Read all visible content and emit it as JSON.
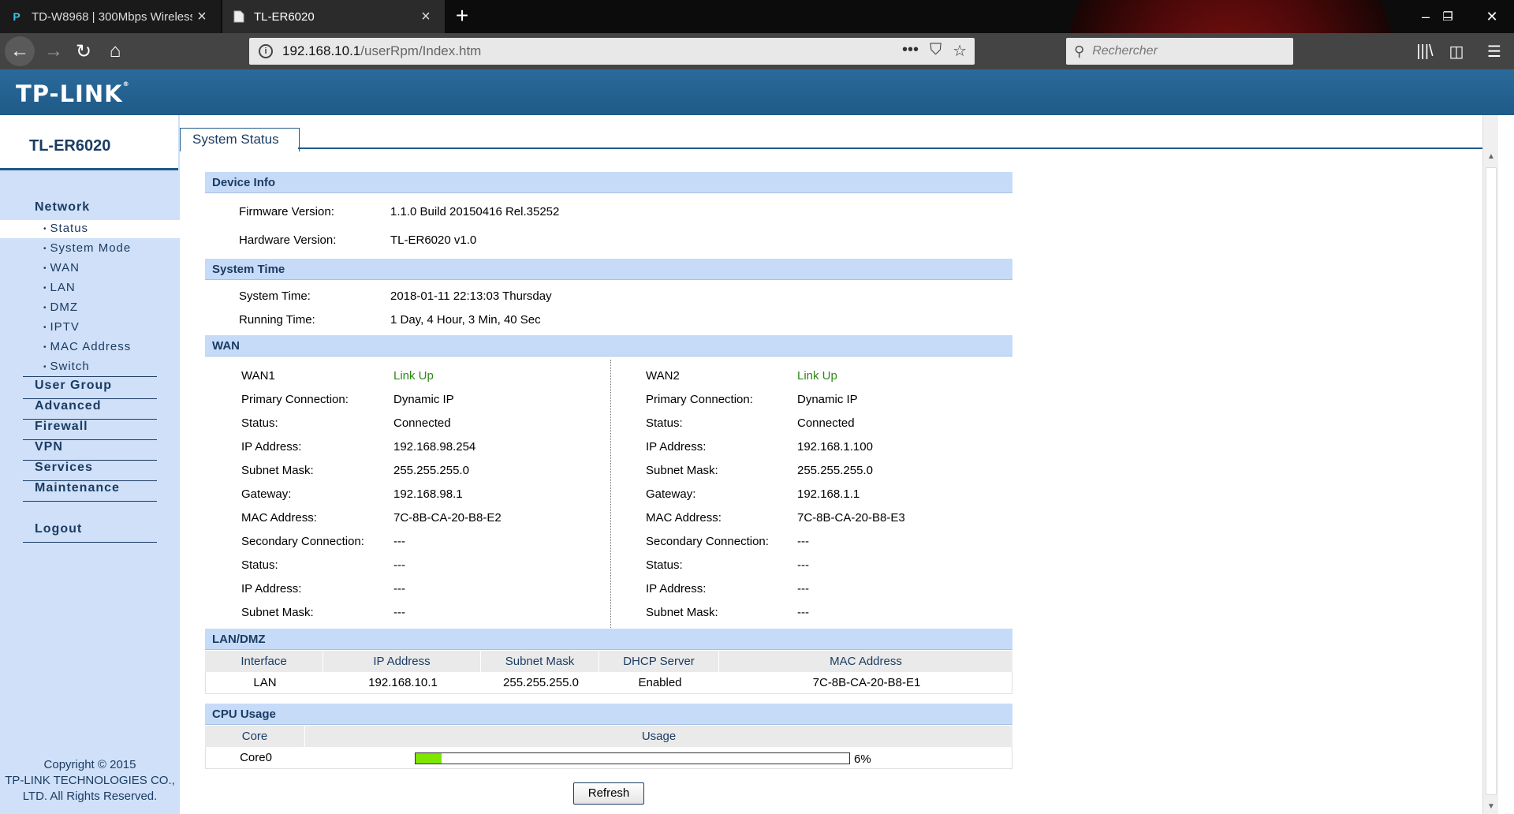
{
  "browser": {
    "tabs": [
      {
        "title": "TD-W8968 | 300Mbps Wireless",
        "active": false
      },
      {
        "title": "TL-ER6020",
        "active": true
      }
    ],
    "url_host": "192.168.10.1",
    "url_path": "/userRpm/Index.htm",
    "search_placeholder": "Rechercher"
  },
  "header": {
    "brand": "TP-LINK"
  },
  "sidebar": {
    "model": "TL-ER6020",
    "network_label": "Network",
    "network_items": [
      "Status",
      "System Mode",
      "WAN",
      "LAN",
      "DMZ",
      "IPTV",
      "MAC Address",
      "Switch"
    ],
    "menu": [
      "User Group",
      "Advanced",
      "Firewall",
      "VPN",
      "Services",
      "Maintenance"
    ],
    "logout": "Logout",
    "copyright": [
      "Copyright © 2015",
      "TP-LINK TECHNOLOGIES CO.,",
      "LTD. All Rights Reserved."
    ]
  },
  "content": {
    "tab_title": "System Status",
    "device_info": {
      "heading": "Device Info",
      "firmware_label": "Firmware Version:",
      "firmware_value": "1.1.0 Build 20150416 Rel.35252",
      "hardware_label": "Hardware Version:",
      "hardware_value": "TL-ER6020 v1.0"
    },
    "system_time": {
      "heading": "System Time",
      "time_label": "System Time:",
      "time_value": "2018-01-11 22:13:03 Thursday",
      "running_label": "Running Time:",
      "running_value": "1 Day, 4 Hour, 3 Min, 40 Sec"
    },
    "wan": {
      "heading": "WAN",
      "labels": [
        "Primary Connection:",
        "Status:",
        "IP Address:",
        "Subnet Mask:",
        "Gateway:",
        "MAC Address:",
        "Secondary Connection:",
        "Status:",
        "IP Address:",
        "Subnet Mask:"
      ],
      "wan1": {
        "name": "WAN1",
        "link": "Link Up",
        "values": [
          "Dynamic IP",
          "Connected",
          "192.168.98.254",
          "255.255.255.0",
          "192.168.98.1",
          "7C-8B-CA-20-B8-E2",
          "---",
          "---",
          "---",
          "---"
        ]
      },
      "wan2": {
        "name": "WAN2",
        "link": "Link Up",
        "values": [
          "Dynamic IP",
          "Connected",
          "192.168.1.100",
          "255.255.255.0",
          "192.168.1.1",
          "7C-8B-CA-20-B8-E3",
          "---",
          "---",
          "---",
          "---"
        ]
      }
    },
    "lan": {
      "heading": "LAN/DMZ",
      "columns": [
        "Interface",
        "IP Address",
        "Subnet Mask",
        "DHCP Server",
        "MAC Address"
      ],
      "row": [
        "LAN",
        "192.168.10.1",
        "255.255.255.0",
        "Enabled",
        "7C-8B-CA-20-B8-E1"
      ]
    },
    "cpu": {
      "heading": "CPU Usage",
      "columns": [
        "Core",
        "Usage"
      ],
      "core": "Core0",
      "usage_percent": 6,
      "usage_text": "6%"
    },
    "refresh_label": "Refresh"
  }
}
